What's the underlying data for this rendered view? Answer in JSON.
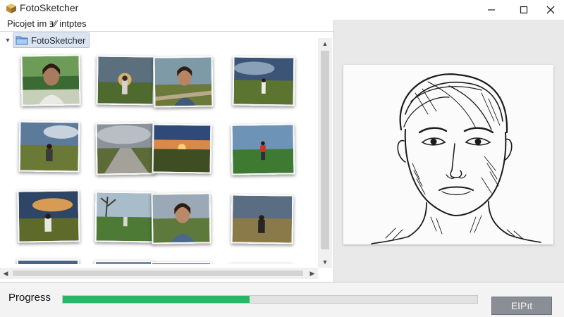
{
  "window": {
    "title": "FotoSketcher",
    "icon": "fotosketcher-app-icon",
    "controls": [
      "minimize-icon",
      "maximize-icon",
      "close-icon"
    ]
  },
  "left_panel": {
    "subtitle": "Picojet im ⱻ⁄⁄ intptes",
    "tree": {
      "node_label": "FotoSketcher",
      "expanded": true
    },
    "thumbnails": [
      {
        "subject": "portrait woman smiling, forest"
      },
      {
        "subject": "person in field, sunset"
      },
      {
        "subject": "portrait woman, road"
      },
      {
        "subject": "person in field, cloudy sky"
      },
      {
        "subject": "woman sitting in grass"
      },
      {
        "subject": "road through field, storm clouds"
      },
      {
        "subject": "sunset over field"
      },
      {
        "subject": "person in red shirt, meadow"
      },
      {
        "subject": "woman in field, sunset"
      },
      {
        "subject": "person under tree, field"
      },
      {
        "subject": "portrait woman, farmland"
      },
      {
        "subject": "woman in dark top, field"
      }
    ]
  },
  "preview": {
    "description": "pencil sketch of a portrait"
  },
  "bottom_bar": {
    "progress_label": "Progress",
    "progress_value": 0.45,
    "progress_color": "#22b865",
    "action_button_label": "EIPıt"
  }
}
